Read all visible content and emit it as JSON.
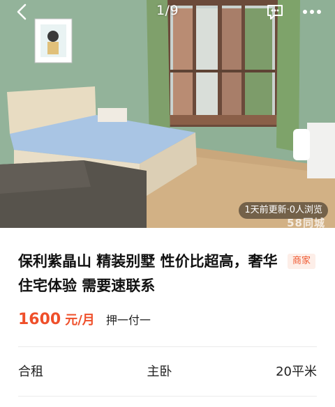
{
  "header": {
    "page_indicator": "1/9",
    "back_icon": "chevron-left-icon",
    "chat_icon": "message-icon",
    "more_icon": "more-dots-icon"
  },
  "photo": {
    "meta": "1天前更新·0人浏览",
    "watermark": "58同城"
  },
  "listing": {
    "title": "保利紫晶山 精装别墅 性价比超高，奢华住宅体验 需要速联系",
    "badge": "商家",
    "price": "1600",
    "price_unit": "元/月",
    "payment": "押一付一"
  },
  "attributes": [
    "合租",
    "主卧",
    "20平米"
  ],
  "colors": {
    "price": "#ef4f2a",
    "badge_text": "#ef5a32",
    "badge_bg": "#fdeee8"
  }
}
